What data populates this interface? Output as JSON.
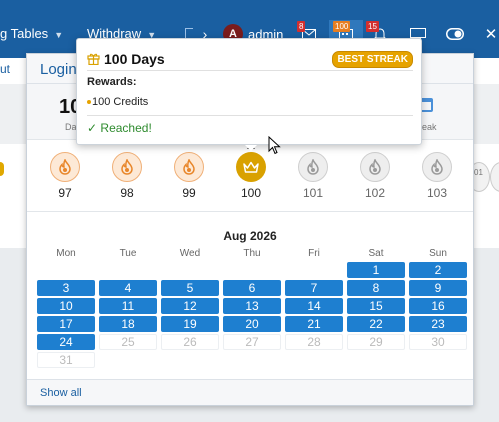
{
  "topbar": {
    "nav1_label": "g Tables",
    "nav2_label": "Withdraw",
    "user_name": "admin",
    "avatar_letter": "A",
    "badges": {
      "mail": "8",
      "streak": "100",
      "alerts": "15"
    }
  },
  "left_link": "ut",
  "panel": {
    "title": "Login",
    "stat_value": "10",
    "stat_left_label": "Da",
    "stat_right_label": "reak"
  },
  "days": [
    {
      "num": "97",
      "state": "past"
    },
    {
      "num": "98",
      "state": "past"
    },
    {
      "num": "99",
      "state": "past"
    },
    {
      "num": "100",
      "state": "current"
    },
    {
      "num": "101",
      "state": "future"
    },
    {
      "num": "102",
      "state": "future"
    },
    {
      "num": "103",
      "state": "future"
    }
  ],
  "right_mini_num": "01",
  "calendar": {
    "title": "Aug 2026",
    "dows": [
      "Mon",
      "Tue",
      "Wed",
      "Thu",
      "Fri",
      "Sat",
      "Sun"
    ],
    "first_weekday_index": 5,
    "days_in_month": 31,
    "last_active_day": 24
  },
  "footer": {
    "show_all": "Show all"
  },
  "tooltip": {
    "title": "100 Days",
    "badge": "BEST STREAK",
    "rewards_label": "Rewards:",
    "reward_item": "100 Credits",
    "status": "Reached!"
  },
  "colors": {
    "brand": "#1a5fa1",
    "active_day": "#1e7fd0",
    "gold": "#d9a100",
    "reached_green": "#2e8b2e"
  }
}
